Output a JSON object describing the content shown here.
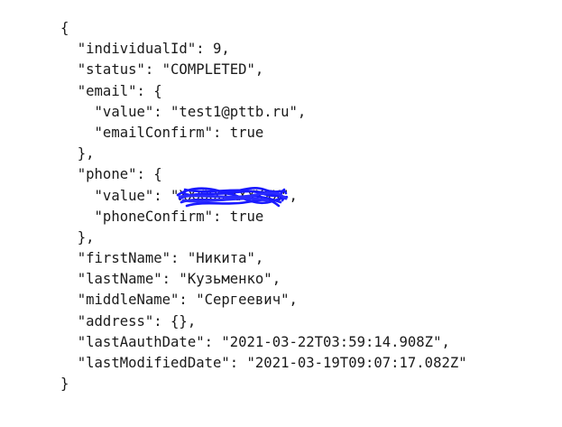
{
  "json_view": {
    "open_brace": "{",
    "close_brace": "}",
    "lines": {
      "individualId": "\"individualId\": 9,",
      "status": "\"status\": \"COMPLETED\",",
      "email_open": "\"email\": {",
      "email_value": "\"value\": \"test1@pttb.ru\",",
      "email_confirm": "\"emailConfirm\": true",
      "email_close": "},",
      "phone_open": "\"phone\": {",
      "phone_value_key": "\"value\": ",
      "phone_value_redacted": "\"XXXXXXXXXXXX\"",
      "phone_value_tail": ",",
      "phone_confirm": "\"phoneConfirm\": true",
      "phone_close": "},",
      "firstName": "\"firstName\": \"Никита\",",
      "lastName": "\"lastName\": \"Кузьменко\",",
      "middleName": "\"middleName\": \"Сергеевич\",",
      "address": "\"address\": {},",
      "lastAauthDate": "\"lastAauthDate\": \"2021-03-22T03:59:14.908Z\",",
      "lastModifiedDate": "\"lastModifiedDate\": \"2021-03-19T09:07:17.082Z\""
    }
  },
  "colors": {
    "text": "#1a1a1a",
    "redaction_scribble": "#1a1aff"
  }
}
